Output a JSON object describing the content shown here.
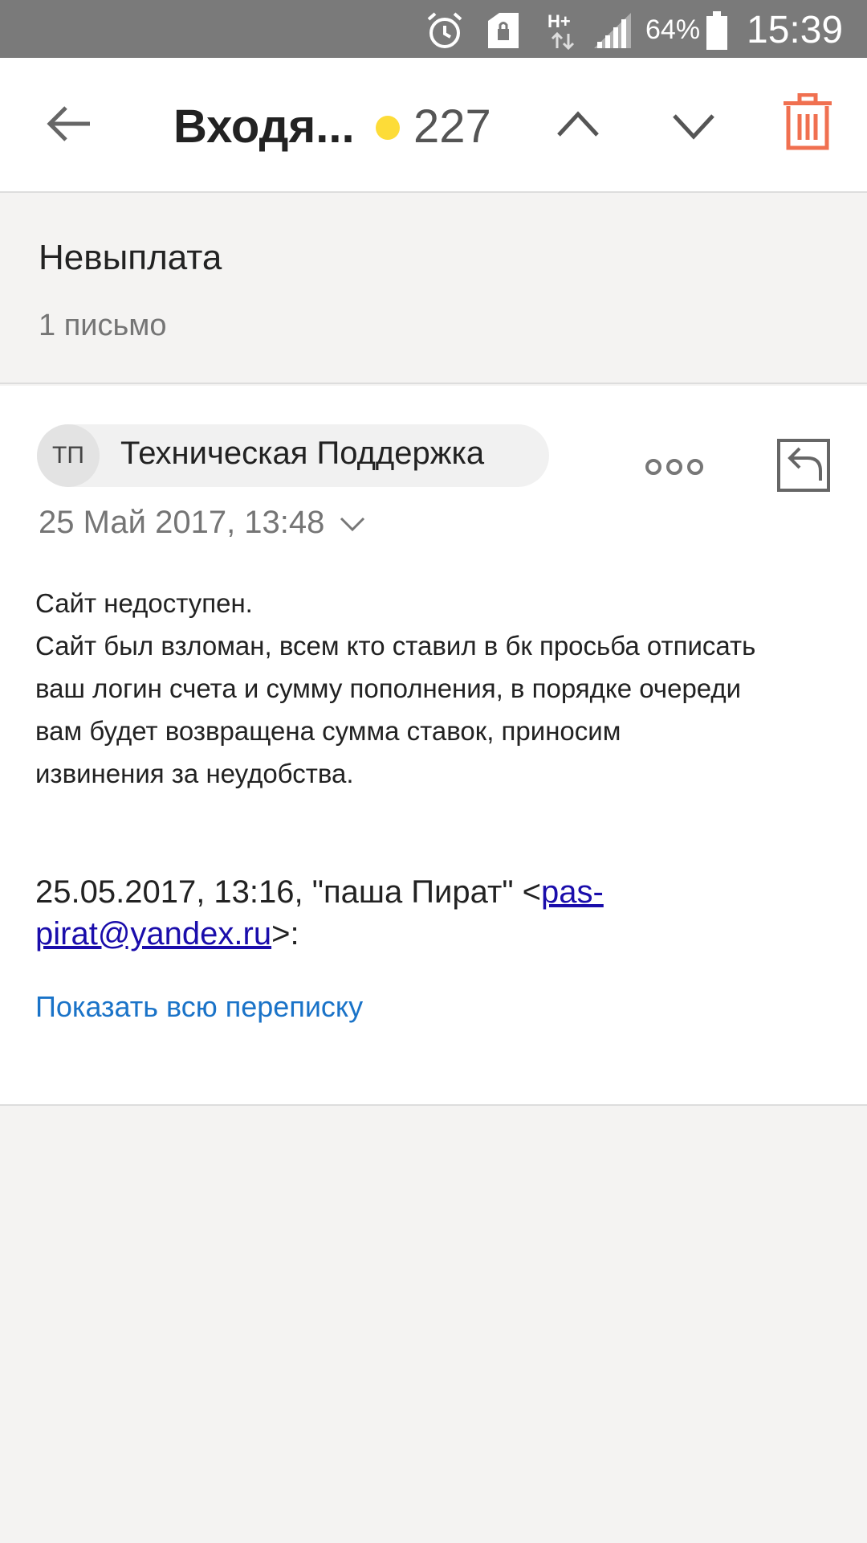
{
  "status_bar": {
    "icons": [
      "alarm-icon",
      "sim-lock-icon",
      "hplus-data-icon",
      "signal-icon",
      "battery-icon"
    ],
    "battery": "64%",
    "time": "15:39"
  },
  "toolbar": {
    "folder": "Входя...",
    "unread_count": "227",
    "accent_color": "#fddc38",
    "icons": [
      "back-arrow-icon",
      "chevron-up-icon",
      "chevron-down-icon",
      "trash-icon"
    ],
    "trash_color": "#f07050"
  },
  "thread": {
    "subject": "Невыплата",
    "count": "1 письмо"
  },
  "message": {
    "avatar": "ТП",
    "sender": "Техническая Поддержка",
    "date": "25 Май 2017, 13:48",
    "body_lines": [
      "Сайт недоступен.",
      "Сайт был взломан, всем кто ставил в бк просьба отписать",
      "ваш логин счета и сумму пополнения, в порядке очереди",
      "вам будет возвращена сумма ставок, приносим",
      "извинения за неудобства."
    ],
    "quote_prefix": "25.05.2017, 13:16, \"паша Пират\" <",
    "quote_email_part1": "pas-",
    "quote_email_part2": "pirat@yandex.ru",
    "quote_suffix": ">:",
    "show_all": "Показать всю переписку",
    "link_color": "#1a73c8"
  }
}
